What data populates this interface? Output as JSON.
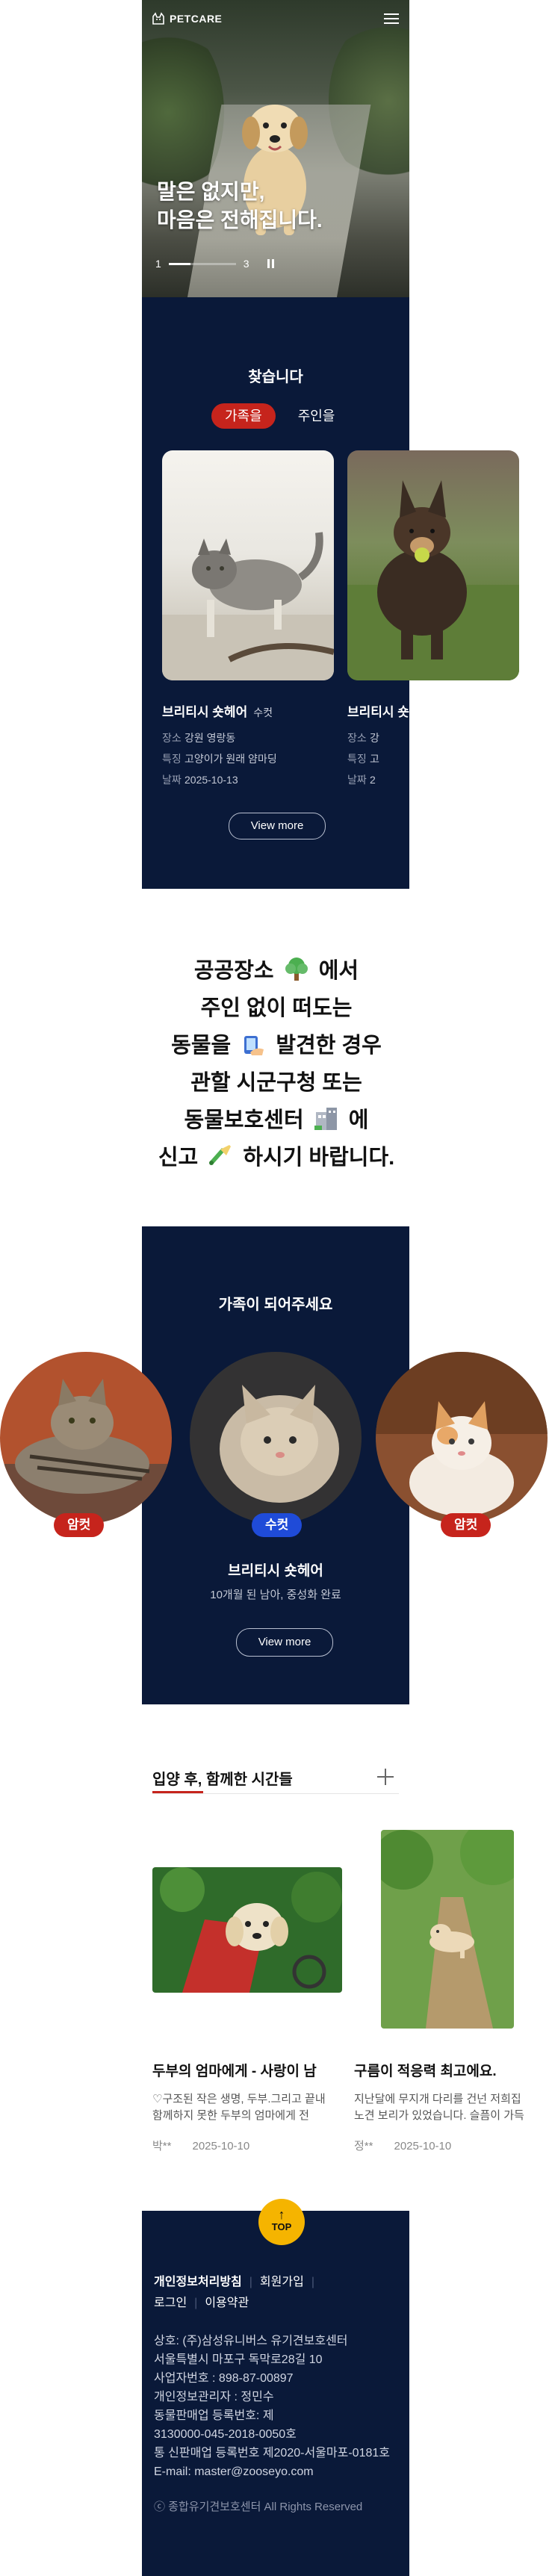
{
  "header": {
    "logo_text": "PETCARE",
    "menu_icon": "hamburger-icon"
  },
  "hero": {
    "title_line1": "말은 없지만,",
    "title_line2": "마음은 전해집니다.",
    "slide_current": "1",
    "slide_total": "3",
    "progress_fraction": 0.33,
    "pause_icon": "pause-icon"
  },
  "find": {
    "heading": "찾습니다",
    "tabs": [
      {
        "label": "가족을",
        "active": true
      },
      {
        "label": "주인을",
        "active": false
      }
    ],
    "cards": [
      {
        "name": "브리티시 숏헤어",
        "sex": "수컷",
        "place_key": "장소",
        "place": "강원 영랑동",
        "feature_key": "특징",
        "feature": "고양이가 원래 얌마딩",
        "date_key": "날짜",
        "date": "2025-10-13"
      },
      {
        "name": "브리티시 숏헤어",
        "sex": "",
        "place_key": "장소",
        "place": "강",
        "feature_key": "특징",
        "feature": "고",
        "date_key": "날짜",
        "date": "2"
      }
    ],
    "more_label": "View more"
  },
  "notice": {
    "line1_a": "공공장소",
    "line1_b": "에서",
    "line2": "주인 없이 떠도는",
    "line3_a": "동물을",
    "line3_b": "발견한 경우",
    "line4": "관할 시군구청 또는",
    "line5_a": "동물보호센터",
    "line5_b": "에",
    "line6_a": "신고",
    "line6_b": "하시기 바랍니다.",
    "icons": [
      "tree-icon",
      "phone-hand-icon",
      "building-icon",
      "megaphone-icon"
    ]
  },
  "adopt": {
    "heading": "가족이 되어주세요",
    "pets": [
      {
        "badge": "암컷"
      },
      {
        "badge": "수컷"
      },
      {
        "badge": "암컷"
      }
    ],
    "name": "브리티시 숏헤어",
    "desc": "10개월 된 남아, 중성화 완료",
    "more_label": "View more",
    "colors": {
      "female": "#c6241c",
      "male": "#1f4bd8"
    }
  },
  "stories": {
    "heading": "입양 후, 함께한 시간들",
    "plus_icon": "plus-icon",
    "items": [
      {
        "title": "두부의 엄마에게 - 사랑이 남",
        "desc1": "♡구조된 작은 생명, 두부.그리고 끝내",
        "desc2": "함께하지 못한 두부의 엄마에게 전",
        "author": "박**",
        "date": "2025-10-10"
      },
      {
        "title": "구름이 적응력 최고에요.",
        "desc1": "지난달에 무지개 다리를 건넌 저희집",
        "desc2": "노견 보리가 있었습니다. 슬픔이 가득",
        "author": "정**",
        "date": "2025-10-10"
      }
    ]
  },
  "footer": {
    "top_label": "TOP",
    "links": [
      "개인정보처리방침",
      "회원가입",
      "로그인",
      "이용약관"
    ],
    "info": [
      "상호: (주)삼성유니버스 유기견보호센터",
      "서울특별시 마포구 독막로28길 10",
      "사업자번호 : 898-87-00897",
      "개인정보관리자 : 정민수",
      "동물판매업 등록번호: 제",
      "3130000-045-2018-0050호",
      "통 신판매업 등록번호 제2020-서울마포-0181호",
      "E-mail: master@zooseyo.com"
    ],
    "copyright": "ⓒ 종합유기견보호센터 All Rights Reserved"
  },
  "colors": {
    "navy": "#0a1939",
    "accent_red": "#c6241c",
    "top_button": "#f5b400"
  }
}
